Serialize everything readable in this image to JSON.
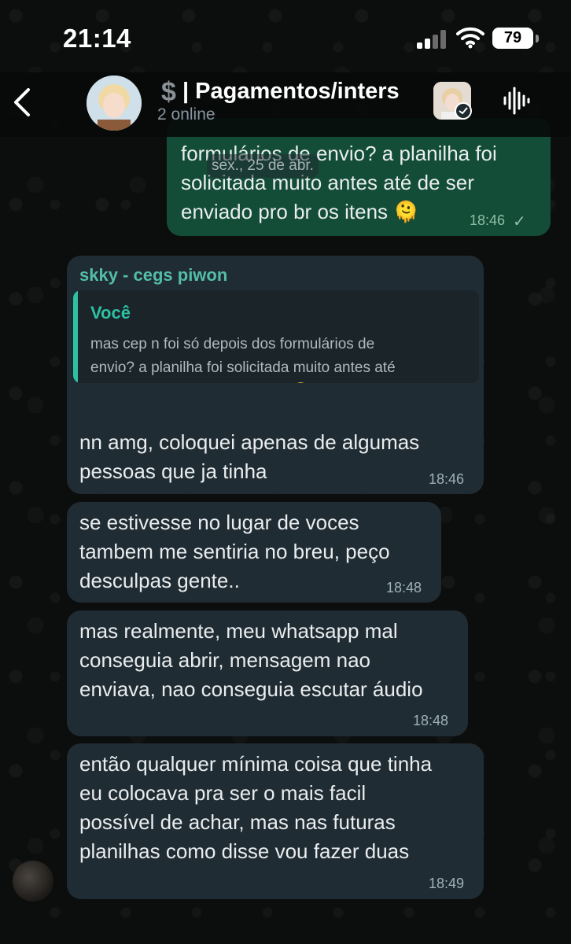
{
  "status_bar": {
    "time": "21:14",
    "battery": "79"
  },
  "header": {
    "title_icon": "$",
    "title": "| Pagamentos/inters",
    "subtitle": "2 online"
  },
  "date_separator": "sex., 25 de abr.",
  "messages": [
    {
      "direction": "outgoing",
      "text": "formulários de envio? a planilha foi\nsolicitada muito antes até de ser\nenviado pro br os itens 🫠",
      "time": "18:46",
      "status": "✓"
    },
    {
      "direction": "incoming",
      "sender": "skky - cegs piwon",
      "quote": {
        "author": "Você",
        "text": "mas cep n foi só depois dos formulários de\nenvio? a planilha foi solicitada muito antes até\nde ser enviado pro br os itens 🫠"
      },
      "text": "nn amg, coloquei apenas de algumas\npessoas que ja tinha",
      "time": "18:46"
    },
    {
      "direction": "incoming",
      "text": "se estivesse no lugar de voces\ntambem me sentiria no breu, peço\ndesculpas gente..",
      "time": "18:48"
    },
    {
      "direction": "incoming",
      "text": "mas realmente, meu whatsapp mal\nconseguia abrir, mensagem nao\nenviava, nao conseguia escutar áudio",
      "time": "18:48"
    },
    {
      "direction": "incoming",
      "text": "então qualquer mínima coisa que tinha\neu colocava pra ser o mais facil\npossível de achar, mas nas futuras\nplanilhas como disse vou fazer duas",
      "time": "18:49"
    }
  ],
  "colors": {
    "outgoing_bubble": "#134d37",
    "incoming_bubble": "#202c33",
    "sender_name": "#53bdaa",
    "quote_accent": "#2fc0a4"
  }
}
